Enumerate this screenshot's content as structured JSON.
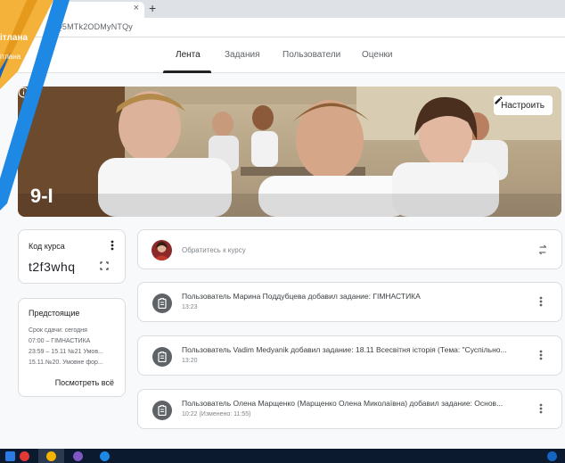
{
  "browser": {
    "url": "/Q5MTk2ODMyNTQy",
    "tab_close": "×",
    "new_tab": "+"
  },
  "account": {
    "name": "ітлана",
    "sub": "ітлана"
  },
  "nav": {
    "tabs": [
      {
        "label": "Лента",
        "active": true
      },
      {
        "label": "Задания",
        "active": false
      },
      {
        "label": "Пользователи",
        "active": false
      },
      {
        "label": "Оценки",
        "active": false
      }
    ]
  },
  "banner": {
    "class_name": "9-І",
    "customize_label": "Настроить"
  },
  "class_code": {
    "label": "Код курса",
    "value": "t2f3whq"
  },
  "upcoming": {
    "title": "Предстоящие",
    "lines": [
      "Срок сдачи: сегодня",
      "07:00 – ГІМНАСТИКА",
      "23:59 – 15.11 №21 Умов...",
      "15.11.№20. Умовне фор..."
    ],
    "view_all": "Посмотреть всё"
  },
  "stream": {
    "announce_placeholder": "Обратитесь к курсу",
    "posts": [
      {
        "title": "Пользователь Марина Поддубцева добавил задание: ГІМНАСТИКА",
        "date": "13:23"
      },
      {
        "title": "Пользователь Vadim Medyanik добавил задание: 18.11 Всесвітня історія (Тема: \"Суспільно...",
        "date": "13:20"
      },
      {
        "title": "Пользователь Олена Марщенко (Марщенко Олена Миколаївна) добавил задание: Основ...",
        "date": "10:22 (Изменено: 11:55)"
      }
    ]
  },
  "colors": {
    "overlay_blue": "#1e88e5",
    "overlay_orange": "#f6b63a",
    "text_primary": "#202124",
    "text_secondary": "#5f6368"
  },
  "icons": [
    "close-icon",
    "plus-icon",
    "pencil-icon",
    "info-icon",
    "more-vert-icon",
    "expand-icon",
    "repost-icon",
    "assignment-icon"
  ]
}
